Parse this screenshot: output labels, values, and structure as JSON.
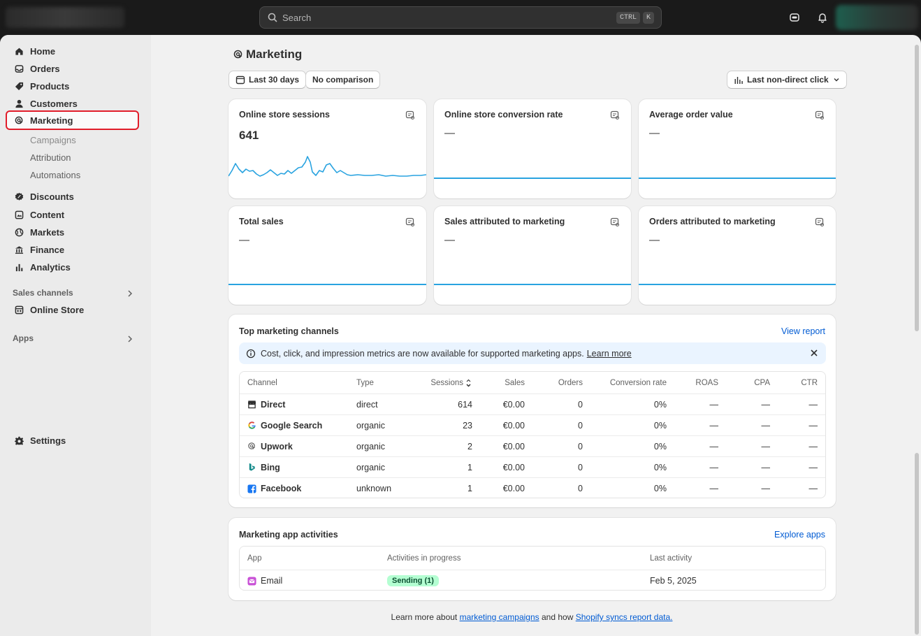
{
  "search": {
    "placeholder": "Search",
    "key1": "CTRL",
    "key2": "K"
  },
  "sidebar": {
    "items": [
      {
        "label": "Home",
        "icon": "home-icon"
      },
      {
        "label": "Orders",
        "icon": "inbox-icon"
      },
      {
        "label": "Products",
        "icon": "tag-icon"
      },
      {
        "label": "Customers",
        "icon": "person-icon"
      },
      {
        "label": "Marketing",
        "icon": "target-icon"
      }
    ],
    "marketing_sub": [
      "Campaigns",
      "Attribution",
      "Automations"
    ],
    "items2": [
      {
        "label": "Discounts",
        "icon": "discount-icon"
      },
      {
        "label": "Content",
        "icon": "content-icon"
      },
      {
        "label": "Markets",
        "icon": "globe-icon"
      },
      {
        "label": "Finance",
        "icon": "bank-icon"
      },
      {
        "label": "Analytics",
        "icon": "chart-icon"
      }
    ],
    "sales_channels_label": "Sales channels",
    "online_store": "Online Store",
    "apps_label": "Apps",
    "settings": "Settings"
  },
  "page": {
    "title": "Marketing",
    "date_range": "Last 30 days",
    "comparison": "No comparison",
    "attribution_model": "Last non-direct click"
  },
  "metrics": [
    {
      "title": "Online store sessions",
      "value": "641"
    },
    {
      "title": "Online store conversion rate",
      "value": "—"
    },
    {
      "title": "Average order value",
      "value": "—"
    },
    {
      "title": "Total sales",
      "value": "—"
    },
    {
      "title": "Sales attributed to marketing",
      "value": "—"
    },
    {
      "title": "Orders attributed to marketing",
      "value": "—"
    }
  ],
  "channels": {
    "title": "Top marketing channels",
    "view_report": "View report",
    "banner_text": "Cost, click, and impression metrics are now available for supported marketing apps.",
    "banner_link": "Learn more",
    "columns": [
      "Channel",
      "Type",
      "Sessions",
      "Sales",
      "Orders",
      "Conversion rate",
      "ROAS",
      "CPA",
      "CTR"
    ],
    "rows": [
      {
        "channel": "Direct",
        "icon": "store-icon",
        "type": "direct",
        "sessions": "614",
        "sales": "€0.00",
        "orders": "0",
        "conv": "0%",
        "roas": "—",
        "cpa": "—",
        "ctr": "—"
      },
      {
        "channel": "Google Search",
        "icon": "google-icon",
        "type": "organic",
        "sessions": "23",
        "sales": "€0.00",
        "orders": "0",
        "conv": "0%",
        "roas": "—",
        "cpa": "—",
        "ctr": "—"
      },
      {
        "channel": "Upwork",
        "icon": "target-icon",
        "type": "organic",
        "sessions": "2",
        "sales": "€0.00",
        "orders": "0",
        "conv": "0%",
        "roas": "—",
        "cpa": "—",
        "ctr": "—"
      },
      {
        "channel": "Bing",
        "icon": "bing-icon",
        "type": "organic",
        "sessions": "1",
        "sales": "€0.00",
        "orders": "0",
        "conv": "0%",
        "roas": "—",
        "cpa": "—",
        "ctr": "—"
      },
      {
        "channel": "Facebook",
        "icon": "facebook-icon",
        "type": "unknown",
        "sessions": "1",
        "sales": "€0.00",
        "orders": "0",
        "conv": "0%",
        "roas": "—",
        "cpa": "—",
        "ctr": "—"
      }
    ]
  },
  "activities": {
    "title": "Marketing app activities",
    "explore": "Explore apps",
    "columns": [
      "App",
      "Activities in progress",
      "Last activity"
    ],
    "rows": [
      {
        "app": "Email",
        "status": "Sending (1)",
        "last": "Feb 5, 2025"
      }
    ]
  },
  "footer": {
    "prefix": "Learn more about",
    "link1": "marketing campaigns",
    "middle": "and how",
    "link2": "Shopify syncs report data."
  },
  "colors": {
    "accent_link": "#005bd3",
    "chart_line": "#29a3e0",
    "highlight_box": "#e11d2a",
    "badge_bg": "#b4fed2"
  }
}
